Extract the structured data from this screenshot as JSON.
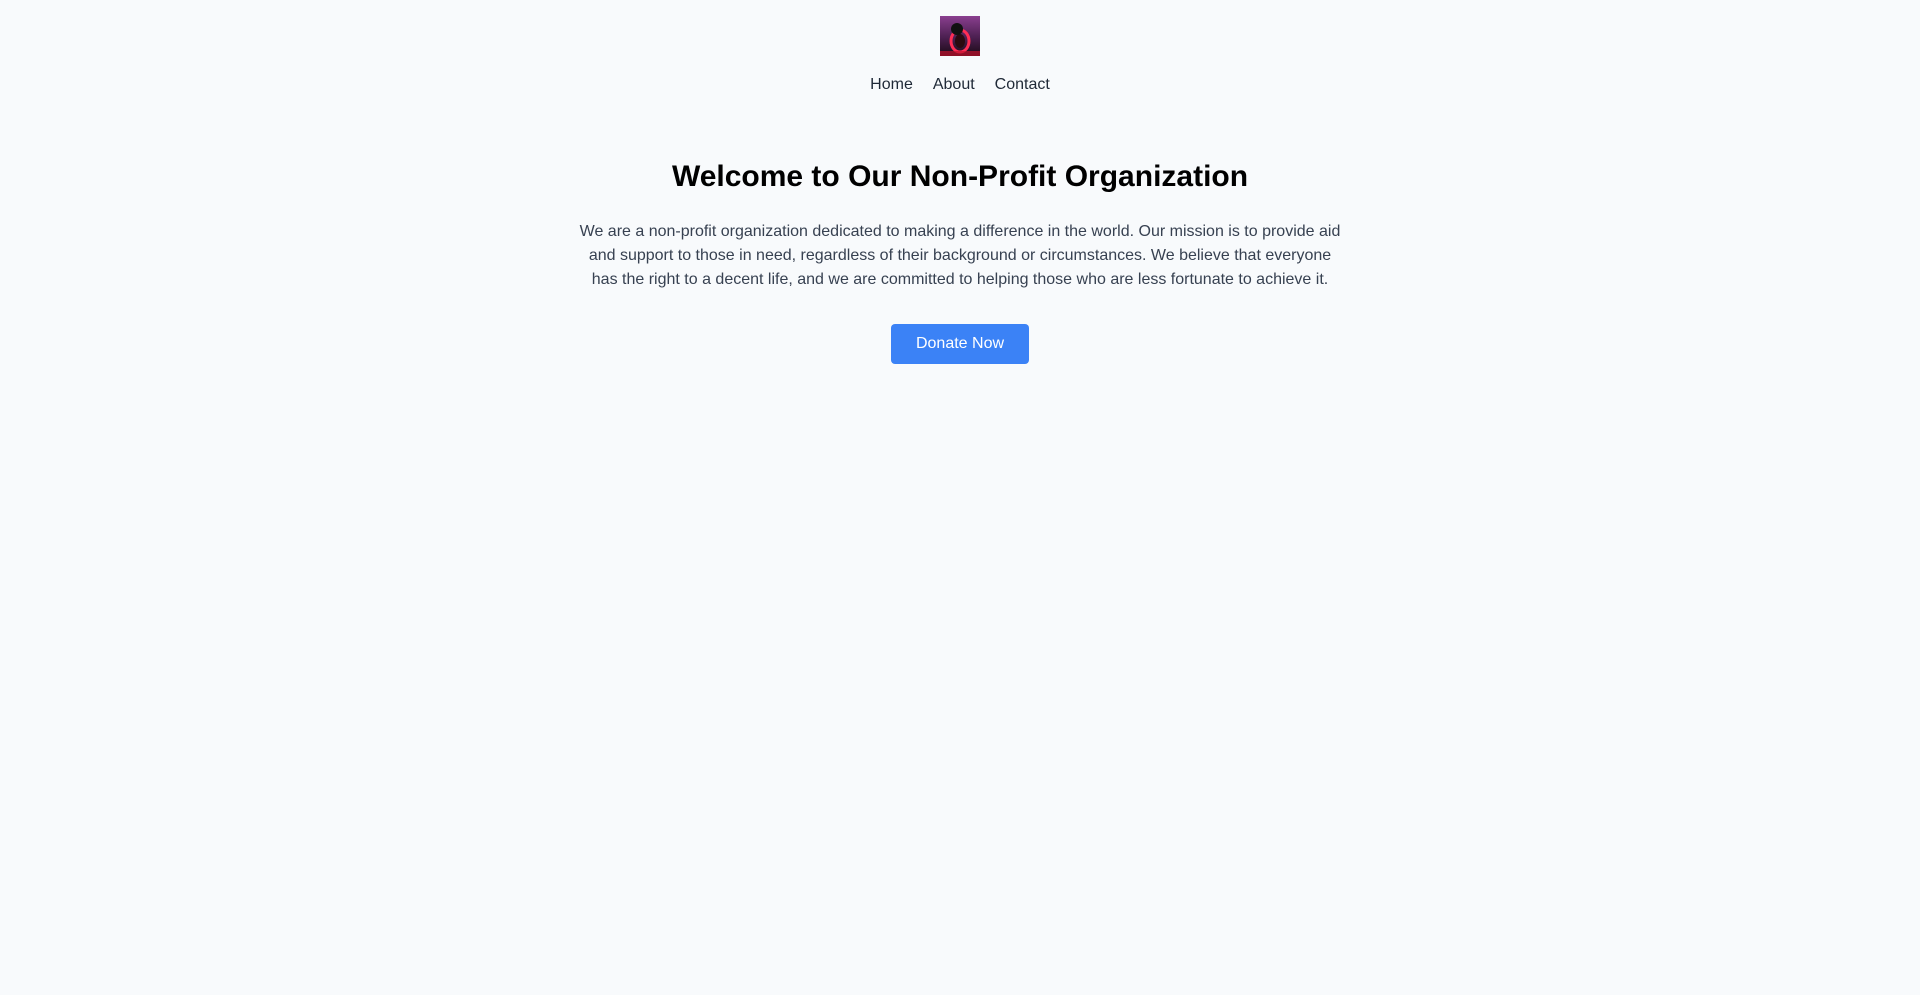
{
  "header": {
    "logo_icon": "neon-ring-avatar-icon",
    "nav": [
      {
        "label": "Home"
      },
      {
        "label": "About"
      },
      {
        "label": "Contact"
      }
    ]
  },
  "hero": {
    "title": "Welcome to Our Non-Profit Organization",
    "description": "We are a non-profit organization dedicated to making a difference in the world. Our mission is to provide aid and support to those in need, regardless of their background or circumstances. We believe that everyone has the right to a decent life, and we are committed to helping those who are less fortunate to achieve it.",
    "cta_label": "Donate Now"
  },
  "colors": {
    "background": "#f8fafc",
    "accent": "#3b82f6",
    "text": "#374151"
  }
}
